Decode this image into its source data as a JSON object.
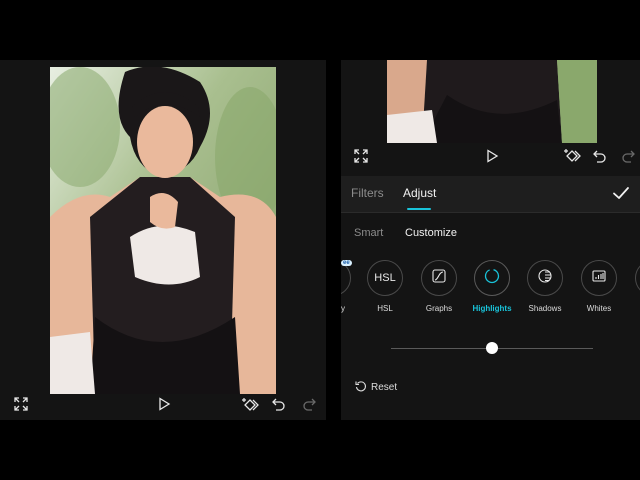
{
  "editor_tabs": {
    "filters": "Filters",
    "adjust": "Adjust"
  },
  "adjust_modes": {
    "smart": "Smart",
    "customize": "Customize"
  },
  "adjust_tools": [
    {
      "label": "y",
      "icon": "partial-tool-icon"
    },
    {
      "label": "HSL",
      "icon": "hsl-icon"
    },
    {
      "label": "Graphs",
      "icon": "curve-graph-icon"
    },
    {
      "label": "Highlights",
      "icon": "highlights-icon",
      "active": true
    },
    {
      "label": "Shadows",
      "icon": "shadows-icon"
    },
    {
      "label": "Whites",
      "icon": "whites-icon"
    }
  ],
  "free_badge": "ee",
  "hsl_icon_text": "HSL",
  "slider": {
    "value": 0.5
  },
  "reset_label": "Reset",
  "colors": {
    "accent": "#19c3d9",
    "panel": "#141414",
    "tabbar": "#1e1e1e"
  }
}
